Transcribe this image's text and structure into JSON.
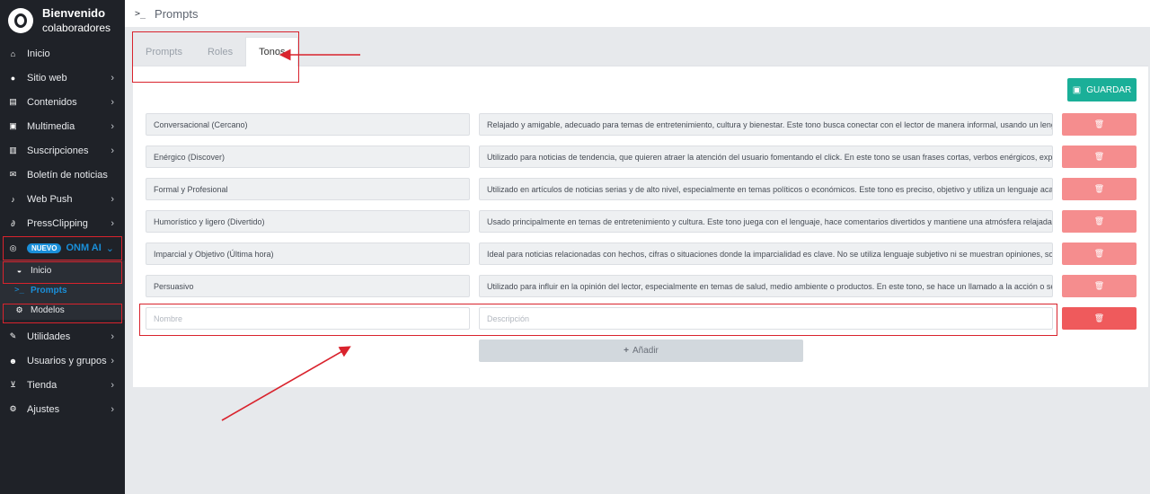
{
  "brand": {
    "title": "Bienvenido",
    "subtitle": "colaboradores"
  },
  "sidebar": {
    "items": [
      {
        "label": "Inicio",
        "icon": "home-icon",
        "chevron": false
      },
      {
        "label": "Sitio web",
        "icon": "globe-icon",
        "chevron": true
      },
      {
        "label": "Contenidos",
        "icon": "newspaper-icon",
        "chevron": true
      },
      {
        "label": "Multimedia",
        "icon": "image-icon",
        "chevron": true
      },
      {
        "label": "Suscripciones",
        "icon": "subscriptions-icon",
        "chevron": true
      },
      {
        "label": "Boletín de noticias",
        "icon": "envelope-icon",
        "chevron": false
      },
      {
        "label": "Web Push",
        "icon": "bell-icon",
        "chevron": true
      },
      {
        "label": "PressClipping",
        "icon": "paperclip-icon",
        "chevron": true
      }
    ],
    "onm": {
      "badge": "NUEVO",
      "label": "ONM AI"
    },
    "onm_sub": [
      {
        "label": "Inicio",
        "icon": "dashboard-icon"
      },
      {
        "label": "Prompts",
        "icon": "terminal-icon"
      },
      {
        "label": "Modelos",
        "icon": "cogs-icon"
      }
    ],
    "items_after": [
      {
        "label": "Utilidades",
        "icon": "wrench-icon",
        "chevron": true
      },
      {
        "label": "Usuarios y grupos",
        "icon": "users-icon",
        "chevron": true
      },
      {
        "label": "Tienda",
        "icon": "cart-icon",
        "chevron": true
      },
      {
        "label": "Ajustes",
        "icon": "settings-icon",
        "chevron": true
      }
    ]
  },
  "header": {
    "icon": ">_",
    "title": "Prompts"
  },
  "tabs": [
    {
      "label": "Prompts"
    },
    {
      "label": "Roles"
    },
    {
      "label": "Tonos"
    }
  ],
  "save_label": "GUARDAR",
  "tones": [
    {
      "name": "Conversacional (Cercano)",
      "description": "Relajado y amigable, adecuado para temas de entretenimiento, cultura y bienestar. Este tono busca conectar con el lector de manera informal, usando un lengua"
    },
    {
      "name": "Enérgico (Discover)",
      "description": "Utilizado para noticias de tendencia, que quieren atraer la atención del usuario fomentando el click. En este tono se usan frases cortas, verbos enérgicos, expre"
    },
    {
      "name": "Formal y Profesional",
      "description": "Utilizado en artículos de noticias serias y de alto nivel, especialmente en temas políticos o económicos. Este tono es preciso, objetivo y utiliza un lenguaje acadé"
    },
    {
      "name": "Humorístico y ligero (Divertido)",
      "description": "Usado principalmente en temas de entretenimiento y cultura. Este tono juega con el lenguaje, hace comentarios divertidos y mantiene una atmósfera relajada,"
    },
    {
      "name": "Imparcial y Objetivo (Última hora)",
      "description": "Ideal para noticias relacionadas con hechos, cifras o situaciones donde la imparcialidad es clave. No se utiliza lenguaje subjetivo ni se muestran opiniones, solo l"
    },
    {
      "name": "Persuasivo",
      "description": "Utilizado para influir en la opinión del lector, especialmente en temas de salud, medio ambiente o productos. En este tono, se hace un llamado a la acción o se c"
    }
  ],
  "new_row": {
    "name_placeholder": "Nombre",
    "description_placeholder": "Descripción"
  },
  "add_label": "Añadir",
  "colors": {
    "accent": "#1a8fd9",
    "save": "#1aaf98",
    "delete": "#f58d8e",
    "annotation": "#d9232d"
  }
}
